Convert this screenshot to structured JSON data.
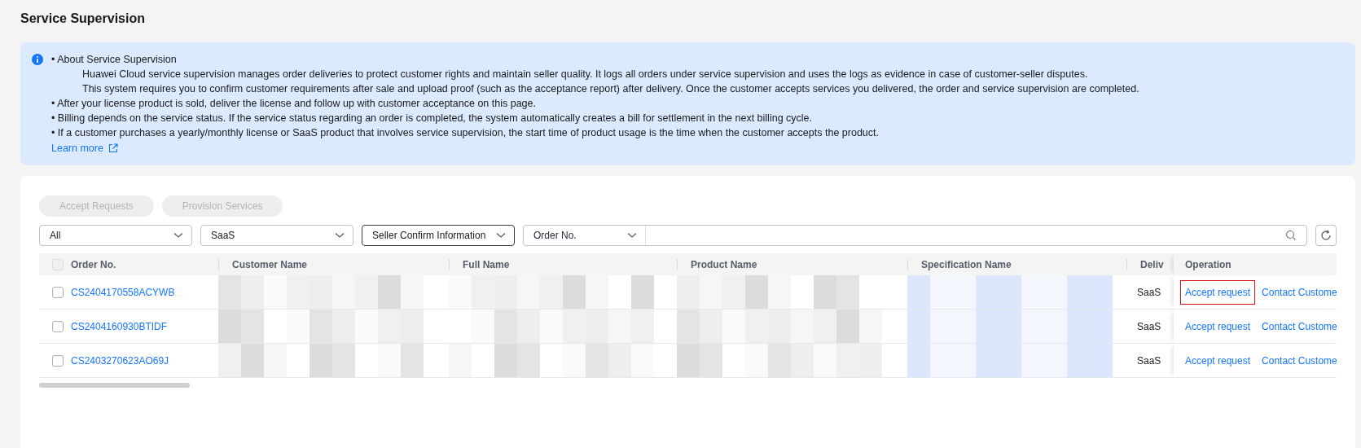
{
  "page_title": "Service Supervision",
  "notice": {
    "heading": "• About Service Supervision",
    "paragraphs": [
      "Huawei Cloud service supervision manages order deliveries to protect customer rights and maintain seller quality. It logs all orders under service supervision and uses the logs as evidence in case of customer-seller disputes.",
      "This system requires you to confirm customer requirements after sale and upload proof (such as the acceptance report) after delivery. Once the customer accepts services you delivered, the order and service supervision are completed."
    ],
    "bullets": [
      "• After your license product is sold, deliver the license and follow up with customer acceptance on this page.",
      "• Billing depends on the service status. If the service status regarding an order is completed, the system automatically creates a bill for settlement in the next billing cycle.",
      "• If a customer purchases a yearly/monthly license or SaaS product that involves service supervision, the start time of product usage is the time when the customer accepts the product."
    ],
    "link": "Learn more"
  },
  "actions": [
    {
      "label": "Accept Requests",
      "disabled": true
    },
    {
      "label": "Provision Services",
      "disabled": true
    }
  ],
  "filters": [
    {
      "value": "All",
      "focused": false
    },
    {
      "value": "SaaS",
      "focused": false
    },
    {
      "value": "Seller Confirm Information",
      "focused": true
    }
  ],
  "search": {
    "field": "Order No."
  },
  "table": {
    "select_all": {
      "checked": false
    },
    "columns": [
      {
        "label": "Order No.",
        "kind": "order"
      },
      {
        "label": "Customer Name",
        "kind": "masked"
      },
      {
        "label": "Full Name",
        "kind": "masked"
      },
      {
        "label": "Product Name",
        "kind": "masked"
      },
      {
        "label": "Specification Name",
        "kind": "masked"
      },
      {
        "label": "Deliv",
        "kind": "delivery"
      }
    ],
    "operation_header": "Operation",
    "rows": [
      {
        "checked": false,
        "order_no": "CS2404170558ACYWB",
        "delivery": "SaaS",
        "operations": [
          {
            "label": "Accept request",
            "highlighted": true
          },
          {
            "label": "Contact Custome",
            "highlighted": false
          }
        ]
      },
      {
        "checked": false,
        "order_no": "CS2404160930BTIDF",
        "delivery": "SaaS",
        "operations": [
          {
            "label": "Accept request",
            "highlighted": false
          },
          {
            "label": "Contact Custome",
            "highlighted": false
          }
        ]
      },
      {
        "checked": false,
        "order_no": "CS2403270623AO69J",
        "delivery": "SaaS",
        "operations": [
          {
            "label": "Accept request",
            "highlighted": false
          },
          {
            "label": "Contact Custome",
            "highlighted": false
          }
        ]
      }
    ]
  }
}
